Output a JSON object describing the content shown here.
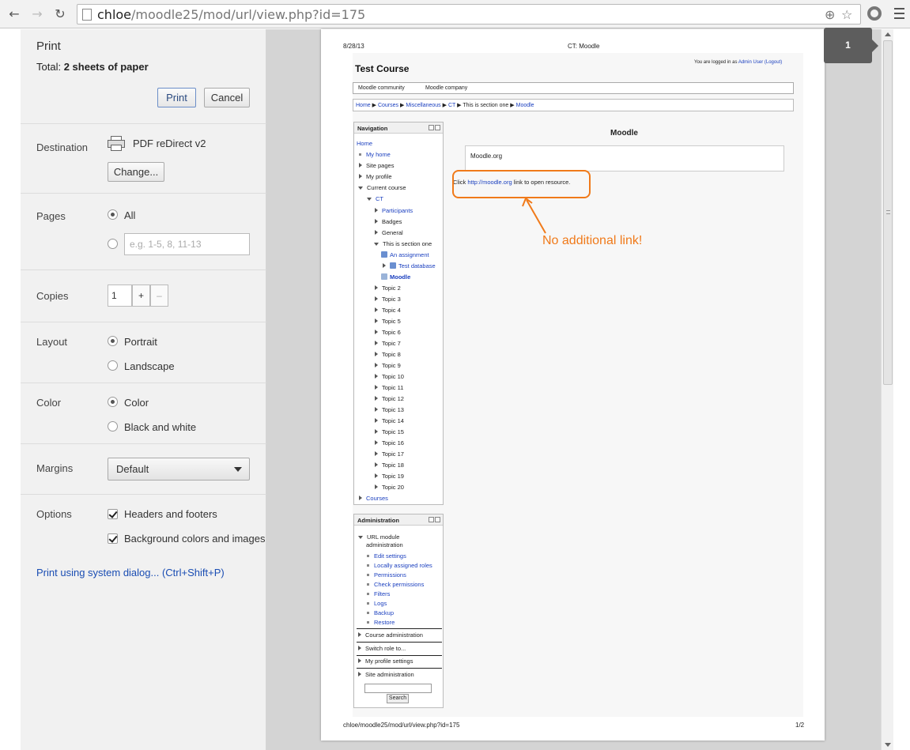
{
  "browser": {
    "url_host": "chloe",
    "url_path": "/moodle25/mod/url/view.php?id=175"
  },
  "print": {
    "title": "Print",
    "total_label": "Total:",
    "total_value": "2 sheets of paper",
    "print_button": "Print",
    "cancel_button": "Cancel",
    "destination_label": "Destination",
    "destination_value": "PDF reDirect v2",
    "change_button": "Change...",
    "pages_label": "Pages",
    "pages_all": "All",
    "pages_placeholder": "e.g. 1-5, 8, 11-13",
    "copies_label": "Copies",
    "copies_value": "1",
    "copies_plus": "+",
    "copies_minus": "–",
    "layout_label": "Layout",
    "layout_portrait": "Portrait",
    "layout_landscape": "Landscape",
    "color_label": "Color",
    "color_color": "Color",
    "color_bw": "Black and white",
    "margins_label": "Margins",
    "margins_value": "Default",
    "options_label": "Options",
    "opt_headers": "Headers and footers",
    "opt_background": "Background colors and images",
    "system_dialog_link": "Print using system dialog... (Ctrl+Shift+P)"
  },
  "preview": {
    "page_badge": "1",
    "header_date": "8/28/13",
    "header_title": "CT: Moodle",
    "footer_url": "chloe/moodle25/mod/url/view.php?id=175",
    "footer_page": "1/2",
    "course_title": "Test Course",
    "logged_in_prefix": "You are logged in as",
    "logged_in_user": "Admin User",
    "logout": "(Logout)",
    "menu": [
      "Moodle community",
      "Moodle company"
    ],
    "breadcrumb": {
      "home": "Home",
      "courses": "Courses",
      "misc": "Miscellaneous",
      "ct": "CT",
      "section": "This is section one",
      "moodle": "Moodle"
    },
    "navigation": {
      "title": "Navigation",
      "home": "Home",
      "my_home": "My home",
      "site_pages": "Site pages",
      "my_profile": "My profile",
      "current_course": "Current course",
      "ct": "CT",
      "participants": "Participants",
      "badges": "Badges",
      "general": "General",
      "section_one": "This is section one",
      "assignment": "An assignment",
      "test_database": "Test database",
      "moodle": "Moodle",
      "topics": [
        "Topic 2",
        "Topic 3",
        "Topic 4",
        "Topic 5",
        "Topic 6",
        "Topic 7",
        "Topic 8",
        "Topic 9",
        "Topic 10",
        "Topic 11",
        "Topic 12",
        "Topic 13",
        "Topic 14",
        "Topic 15",
        "Topic 16",
        "Topic 17",
        "Topic 18",
        "Topic 19",
        "Topic 20"
      ],
      "courses": "Courses"
    },
    "administration": {
      "title": "Administration",
      "url_module_1": "URL module",
      "url_module_2": "administration",
      "items": [
        "Edit settings",
        "Locally assigned roles",
        "Permissions",
        "Check permissions",
        "Filters",
        "Logs",
        "Backup",
        "Restore"
      ],
      "course_admin": "Course administration",
      "switch_role": "Switch role to...",
      "profile_settings": "My profile settings",
      "site_admin": "Site administration",
      "search_button": "Search"
    },
    "main": {
      "heading": "Moodle",
      "url_box": "Moodle.org",
      "click_prefix": "Click",
      "click_link": "http://moodle.org",
      "click_suffix": "link to open resource."
    },
    "annotation": "No additional link!"
  }
}
